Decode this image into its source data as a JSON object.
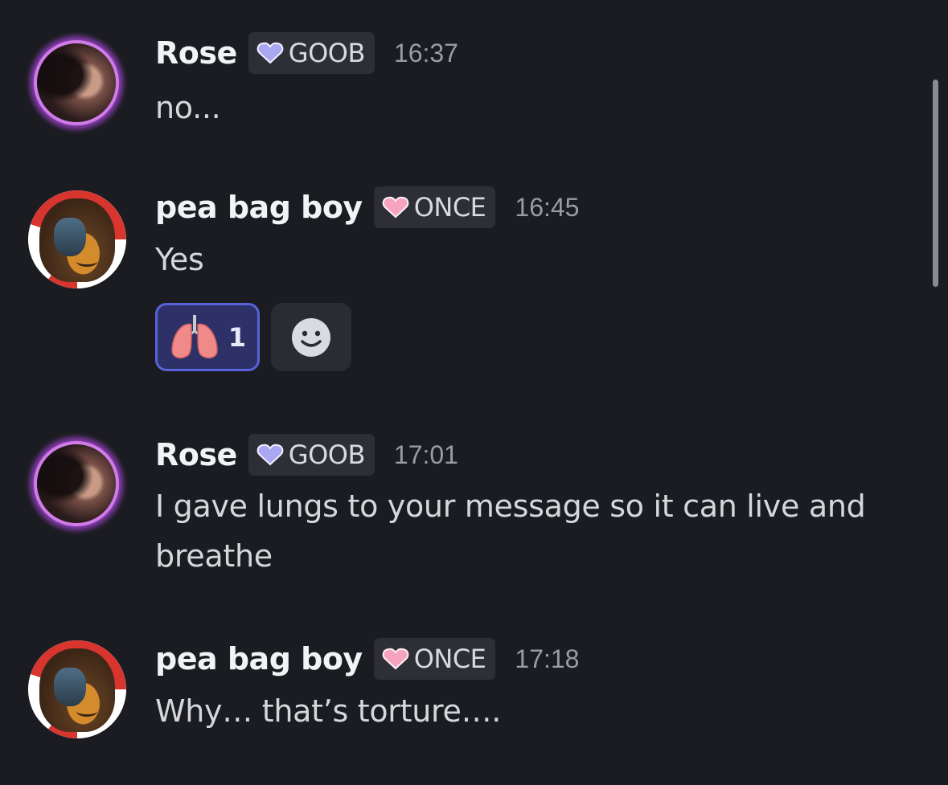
{
  "messages": [
    {
      "username": "Rose",
      "tag": {
        "label": "GOOB",
        "heart_color": "#a9a6f2"
      },
      "time": "16:37",
      "lines": [
        "no..."
      ]
    },
    {
      "username": "pea bag boy",
      "tag": {
        "label": "ONCE",
        "heart_color": "#f7a3c0"
      },
      "time": "16:45",
      "lines": [
        "Yes"
      ],
      "reactions": [
        {
          "emoji": "🫁",
          "emoji_name": "lungs-icon",
          "count": "1",
          "active": true
        }
      ],
      "add_reaction_icon": "smiley-face-icon"
    },
    {
      "username": "Rose",
      "tag": {
        "label": "GOOB",
        "heart_color": "#a9a6f2"
      },
      "time": "17:01",
      "lines": [
        "I gave lungs to your message so it can live and",
        "breathe"
      ]
    },
    {
      "username": "pea bag boy",
      "tag": {
        "label": "ONCE",
        "heart_color": "#f7a3c0"
      },
      "time": "17:18",
      "lines": [
        "Why… that’s torture…."
      ]
    }
  ],
  "colors": {
    "background": "#1b1c21",
    "tag_background": "#2e2f36",
    "reaction_active_bg": "#2d3168",
    "reaction_active_border": "#5762d8"
  }
}
